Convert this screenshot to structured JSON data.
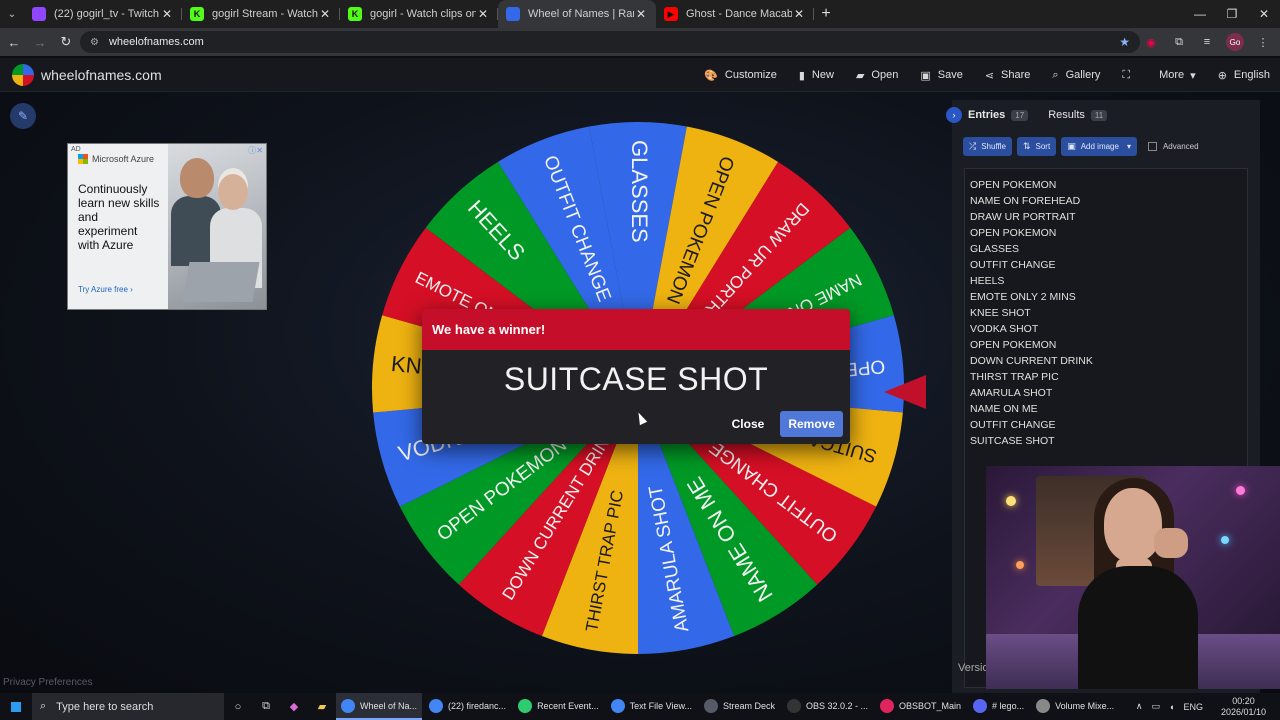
{
  "browser": {
    "tabs": [
      {
        "title": "(22) gogirl_tv - Twitch",
        "favicon_color": "#9146ff",
        "favicon_glyph": "",
        "active": false
      },
      {
        "title": "gogirl Stream - Watch Live on K",
        "favicon_color": "#53fc18",
        "favicon_glyph": "K",
        "active": false
      },
      {
        "title": "gogirl - Watch clips on Kick",
        "favicon_color": "#53fc18",
        "favicon_glyph": "K",
        "active": false
      },
      {
        "title": "Wheel of Names | Random nam",
        "favicon_color": "#3369e8",
        "favicon_glyph": "",
        "active": true
      },
      {
        "title": "Ghost - Dance Macabre (Officia",
        "favicon_color": "#ff0000",
        "favicon_glyph": "▶",
        "active": false
      }
    ],
    "url": "wheelofnames.com",
    "profile_initials": "Go"
  },
  "site": {
    "name": "wheelofnames.com",
    "menu": [
      {
        "label": "Customize",
        "icon": "palette-icon",
        "glyph": "🎨"
      },
      {
        "label": "New",
        "icon": "file-icon",
        "glyph": "▮"
      },
      {
        "label": "Open",
        "icon": "folder-icon",
        "glyph": "▰"
      },
      {
        "label": "Save",
        "icon": "save-icon",
        "glyph": "▣"
      },
      {
        "label": "Share",
        "icon": "share-icon",
        "glyph": "⋖"
      },
      {
        "label": "Gallery",
        "icon": "search-icon",
        "glyph": "⌕"
      },
      {
        "label": "",
        "icon": "fullscreen-icon",
        "glyph": "⛶"
      },
      {
        "label": "More",
        "icon": "chevron-down-icon",
        "glyph": "▾"
      },
      {
        "label": "English",
        "icon": "globe-icon",
        "glyph": "⊕"
      }
    ]
  },
  "ad": {
    "label": "AD",
    "brand": "Microsoft Azure",
    "copy": "Continuously learn new skills and experiment with Azure",
    "cta": "Try Azure free ›"
  },
  "privacy": "Privacy Preferences",
  "wheel": {
    "segments": [
      "GLASSES",
      "OPEN POKEMON",
      "DRAW UR PORTRAIT",
      "NAME ON FOREHEAD",
      "OPEN POKEMON",
      "SUITCASE SHOT",
      "OUTFIT CHANGE",
      "NAME ON ME",
      "AMARULA SHOT",
      "THIRST TRAP PIC",
      "DOWN CURRENT DRINK",
      "OPEN POKEMON",
      "VODKA SHOT",
      "KNEE SHOT",
      "EMOTE ONLY 2 MINS",
      "HEELS",
      "OUTFIT CHANGE"
    ],
    "colors": [
      "#3369e8",
      "#eeb211",
      "#d50f25",
      "#009925"
    ]
  },
  "winner_dialog": {
    "title": "We have a winner!",
    "winner": "SUITCASE SHOT",
    "close_label": "Close",
    "remove_label": "Remove"
  },
  "panel": {
    "entries_tab": "Entries",
    "entries_count": "17",
    "results_tab": "Results",
    "results_count": "11",
    "shuffle": "Shuffle",
    "sort": "Sort",
    "add_image": "Add image",
    "advanced": "Advanced",
    "entries": [
      "OPEN POKEMON",
      "NAME ON FOREHEAD",
      "DRAW UR PORTRAIT",
      "OPEN POKEMON",
      "GLASSES",
      "OUTFIT CHANGE",
      "HEELS",
      "EMOTE ONLY 2 MINS",
      "KNEE SHOT",
      "VODKA SHOT",
      "OPEN POKEMON",
      "DOWN CURRENT DRINK",
      "THIRST TRAP PIC",
      "AMARULA SHOT",
      "NAME ON ME",
      "OUTFIT CHANGE",
      "SUITCASE SHOT"
    ],
    "version": "Versio"
  },
  "taskbar": {
    "search_placeholder": "Type here to search",
    "apps": [
      {
        "label": "Wheel of Na...",
        "color": "#4285f4",
        "active": true
      },
      {
        "label": "(22) firedanc...",
        "color": "#4285f4",
        "active": false
      },
      {
        "label": "Recent Event...",
        "color": "#2ecc71",
        "active": false
      },
      {
        "label": "Text File View...",
        "color": "#4285f4",
        "active": false
      },
      {
        "label": "Stream Deck",
        "color": "#555a66",
        "active": false
      },
      {
        "label": "OBS 32.0.2 - ...",
        "color": "#333",
        "active": false
      },
      {
        "label": "OBSBOT_Main",
        "color": "#e0245e",
        "active": false
      },
      {
        "label": "# lego...",
        "color": "#5865f2",
        "active": false
      },
      {
        "label": "Volume Mixe...",
        "color": "#888",
        "active": false
      }
    ],
    "lang": "ENG",
    "time": "00:20",
    "date": "2026/01/10"
  }
}
